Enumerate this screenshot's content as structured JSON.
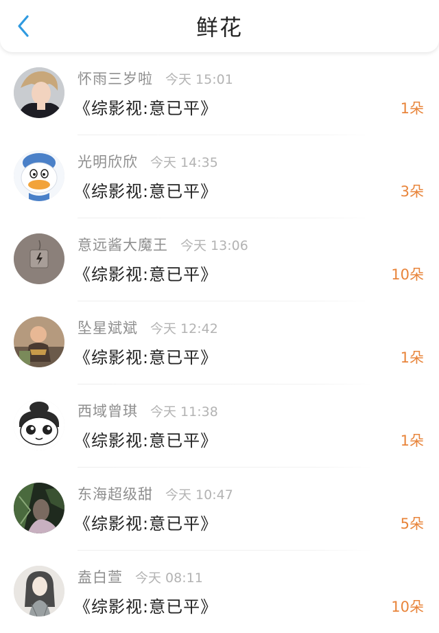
{
  "header": {
    "title": "鲜花",
    "back_icon": "chevron-left-icon",
    "accent_color": "#2f9ae0"
  },
  "count_color": "#e8843a",
  "items": [
    {
      "user": "怀雨三岁啦",
      "time": "今天 15:01",
      "book": "《综影视:意已平》",
      "count": "1朵",
      "avatar": "avatar-photo-boy"
    },
    {
      "user": "光明欣欣",
      "time": "今天 14:35",
      "book": "《综影视:意已平》",
      "count": "3朵",
      "avatar": "avatar-duck"
    },
    {
      "user": "意远酱大魔王",
      "time": "今天 13:06",
      "book": "《综影视:意已平》",
      "count": "10朵",
      "avatar": "avatar-tag"
    },
    {
      "user": "坠星斌斌",
      "time": "今天 12:42",
      "book": "《综影视:意已平》",
      "count": "1朵",
      "avatar": "avatar-baby"
    },
    {
      "user": "西域曾琪",
      "time": "今天 11:38",
      "book": "《综影视:意已平》",
      "count": "1朵",
      "avatar": "avatar-cartoon-face"
    },
    {
      "user": "东海超级甜",
      "time": "今天 10:47",
      "book": "《综影视:意已平》",
      "count": "5朵",
      "avatar": "avatar-dark-photo"
    },
    {
      "user": "盍白萱",
      "time": "今天 08:11",
      "book": "《综影视:意已平》",
      "count": "10朵",
      "avatar": "avatar-girl-sketch"
    }
  ]
}
